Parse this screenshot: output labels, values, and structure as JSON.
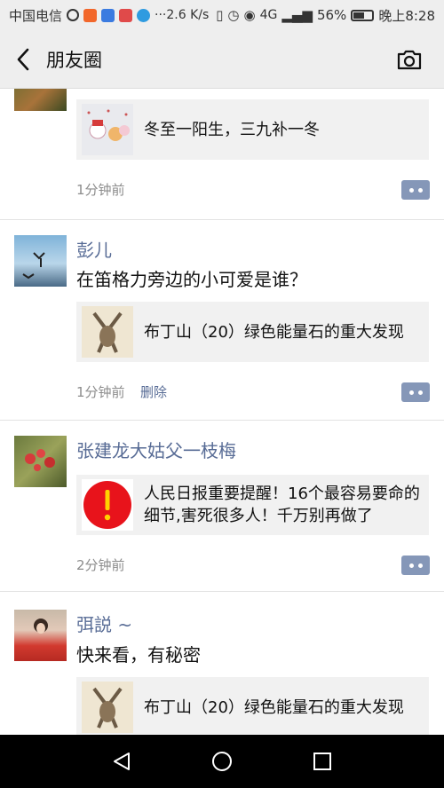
{
  "status_bar": {
    "carrier": "中国电信",
    "speed": "···2.6 K/s",
    "network": "4G",
    "battery": "56%",
    "time": "晚上8:28"
  },
  "nav": {
    "title": "朋友圈"
  },
  "posts": [
    {
      "card_text": "冬至一阳生，三九补一冬",
      "time": "1分钟前"
    },
    {
      "author": "彭儿",
      "text": "在笛格力旁边的小可爱是谁？",
      "card_text": "布丁山（20）绿色能量石的重大发现",
      "time": "1分钟前",
      "delete": "删除"
    },
    {
      "author": "张建龙大姑父一枝梅",
      "card_text": "人民日报重要提醒！16个最容易要命的细节,害死很多人！千万别再做了",
      "time": "2分钟前"
    },
    {
      "author": "弭説 ~",
      "text": "快来看，有秘密",
      "card_text": "布丁山（20）绿色能量石的重大发现"
    }
  ],
  "colors": {
    "link_blue": "#576b95",
    "card_bg": "#f1f1f1",
    "alert_red": "#e8131b"
  }
}
